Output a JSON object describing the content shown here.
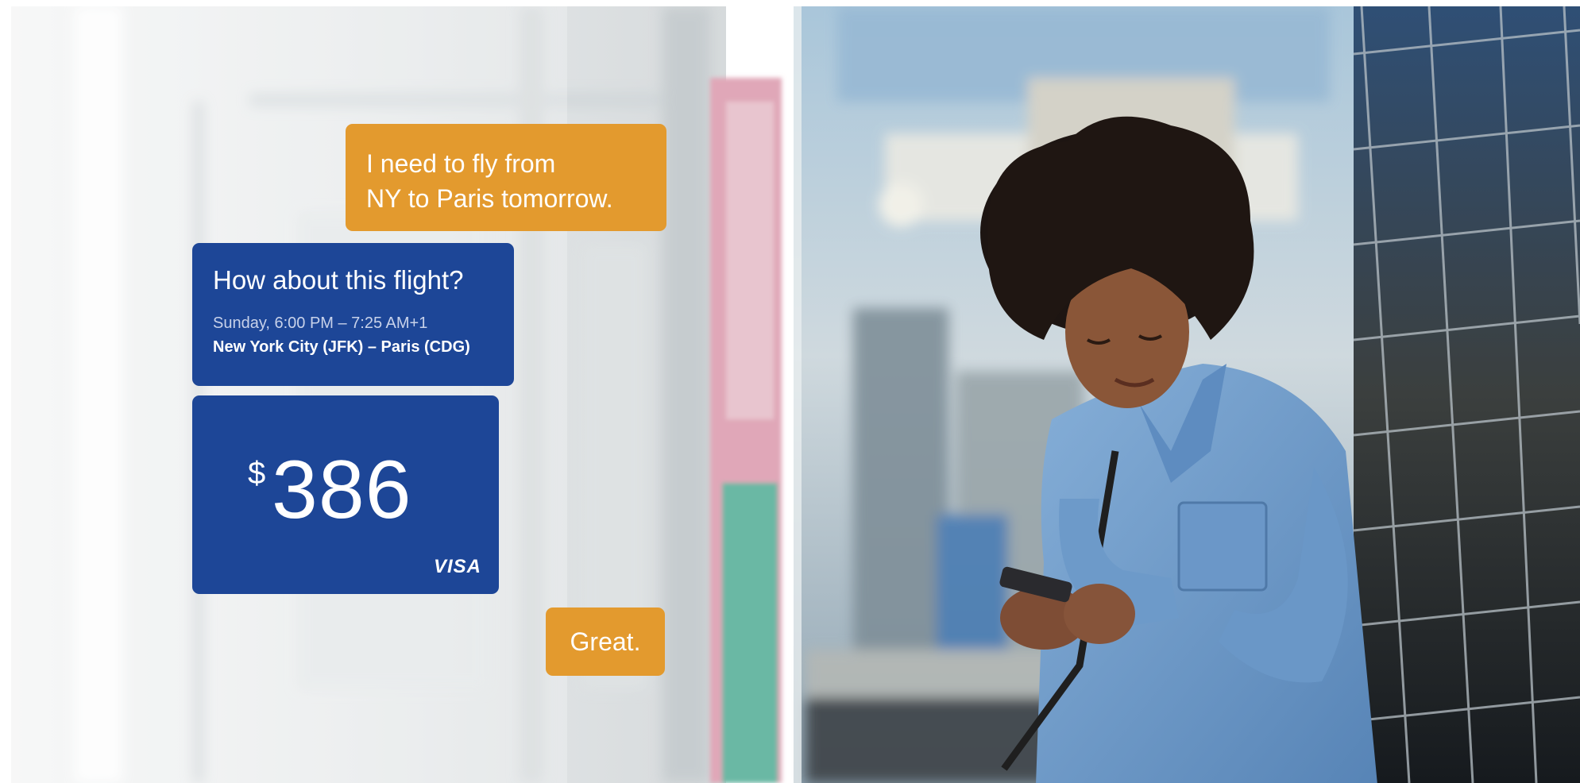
{
  "conversation": {
    "user_message_1": {
      "line1": "I need to fly from",
      "line2": "NY to Paris tomorrow."
    },
    "bot_message_1": {
      "question": "How about this flight?",
      "time": "Sunday, 6:00 PM – 7:25 AM+1",
      "route": "New York City (JFK) – Paris (CDG)"
    },
    "bot_message_2": {
      "currency": "$",
      "amount": "386",
      "card_brand": "VISA"
    },
    "user_message_2": {
      "text": "Great."
    }
  },
  "colors": {
    "user_bubble": "#e39a2e",
    "bot_bubble": "#1d4697",
    "shirt": "#6f9bc9",
    "tile_wall": "#27384a"
  }
}
